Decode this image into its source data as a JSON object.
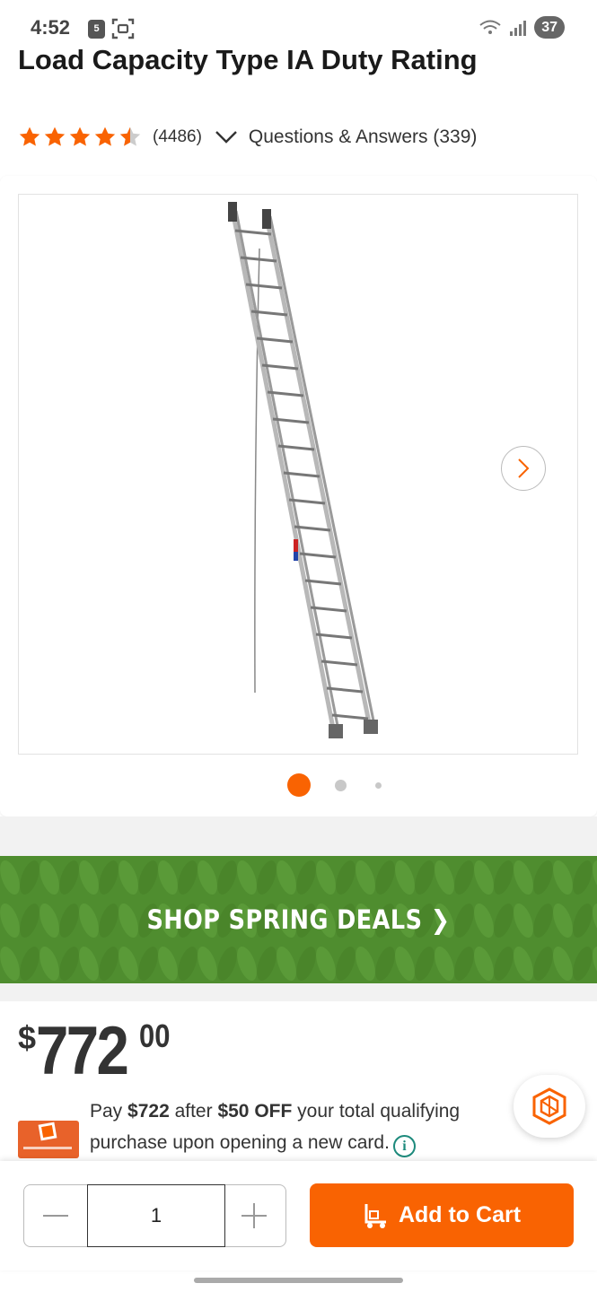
{
  "status_bar": {
    "time": "4:52",
    "notification_badge": "5",
    "battery": "37"
  },
  "product": {
    "title": "Load Capacity Type IA Duty Rating",
    "rating": 4.5,
    "review_count": "(4486)",
    "qa_label": "Questions & Answers (339)"
  },
  "gallery": {
    "current_index": 1,
    "total_images": 3,
    "image_name": "extension-ladder-image"
  },
  "banner": {
    "label": "SHOP SPRING DEALS ❯"
  },
  "price": {
    "currency": "$",
    "dollars": "772",
    "cents": "00"
  },
  "promo": {
    "prefix": "Pay ",
    "amount": "$722",
    "middle": " after ",
    "discount": "$50 OFF",
    "suffix": " your total qualifying purchase upon opening a new card."
  },
  "cart": {
    "quantity": "1",
    "add_label": "Add to Cart"
  },
  "colors": {
    "accent": "#f96302",
    "banner_green": "#4f8d2f",
    "info_teal": "#1d8a7c"
  }
}
